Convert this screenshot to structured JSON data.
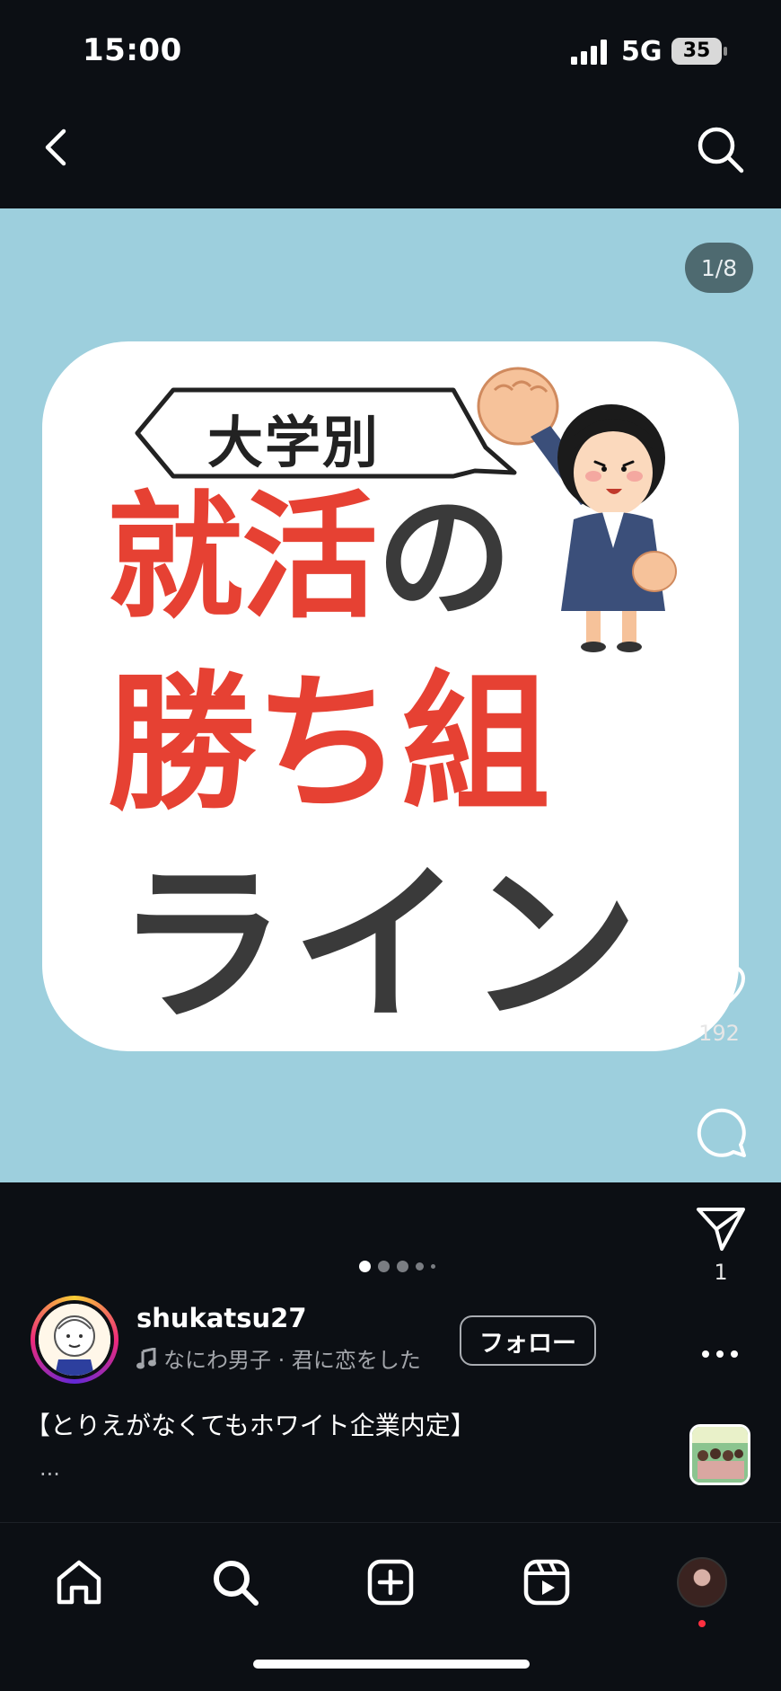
{
  "status_bar": {
    "time": "15:00",
    "network": "5G",
    "battery": "35"
  },
  "post": {
    "counter": "1/8",
    "image_text": {
      "bubble": "大学別",
      "line1_main": "就活",
      "line1_particle": "の",
      "line2": "勝ち組",
      "line3": "ライン"
    },
    "likes": "192",
    "shares": "1"
  },
  "author": {
    "username": "shukatsu27",
    "music": "なにわ男子 · 君に恋をした",
    "follow_label": "フォロー"
  },
  "caption": {
    "text": "【とりえがなくてもホワイト企業内定】",
    "more": "..."
  },
  "icons": {
    "back": "chevron-left-icon",
    "search": "search-icon",
    "like": "heart-icon",
    "comment": "comment-icon",
    "share": "send-icon",
    "more": "more-icon",
    "music": "music-note-icon",
    "nav": [
      "home-icon",
      "search-icon",
      "create-icon",
      "reels-icon",
      "profile-avatar"
    ]
  },
  "colors": {
    "background": "#0c0f14",
    "post_bg": "#9dcfdd",
    "title_red": "#e64133",
    "title_dark": "#3a3a3a",
    "notification": "#ff3040"
  }
}
